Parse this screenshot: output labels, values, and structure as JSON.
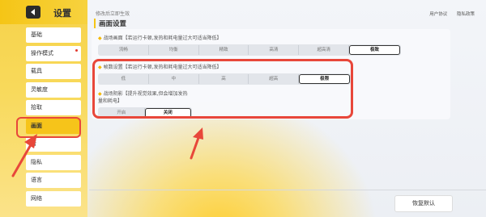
{
  "header": {
    "title": "设置",
    "hint": "修改后立即生效",
    "links": [
      "用户协议",
      "隐私政策"
    ]
  },
  "nav": {
    "items": [
      {
        "label": "基础",
        "dot": false,
        "active": false
      },
      {
        "label": "操作模式",
        "dot": true,
        "active": false
      },
      {
        "label": "载具",
        "dot": false,
        "active": false
      },
      {
        "label": "灵敏度",
        "dot": false,
        "active": false
      },
      {
        "label": "拾取",
        "dot": false,
        "active": false
      },
      {
        "label": "画面",
        "dot": false,
        "active": true
      },
      {
        "label": "音",
        "dot": false,
        "active": false
      },
      {
        "label": "隐私",
        "dot": false,
        "active": false
      },
      {
        "label": "语言",
        "dot": false,
        "active": false
      },
      {
        "label": "网络",
        "dot": false,
        "active": false
      }
    ]
  },
  "section": {
    "title": "画面设置"
  },
  "groups": [
    {
      "label": "战场画面【若运行卡顿,发热和耗电量过大可适当降低】",
      "options": [
        "流畅",
        "均衡",
        "精致",
        "高清",
        "超高清",
        "极致"
      ],
      "selected": 5
    },
    {
      "label": "帧数设置【若运行卡顿,发热和耗电量过大可适当降低】",
      "options": [
        "低",
        "中",
        "高",
        "超高",
        "极限"
      ],
      "selected": 4
    },
    {
      "label": "战场阴影【提升视觉效果,但会增加发热量和耗电】",
      "options": [
        "开启",
        "关闭"
      ],
      "selected": 1
    }
  ],
  "footer": {
    "restore_label": "恢复默认"
  },
  "colors": {
    "accent": "#f5c516",
    "annotation": "#e8473a"
  }
}
